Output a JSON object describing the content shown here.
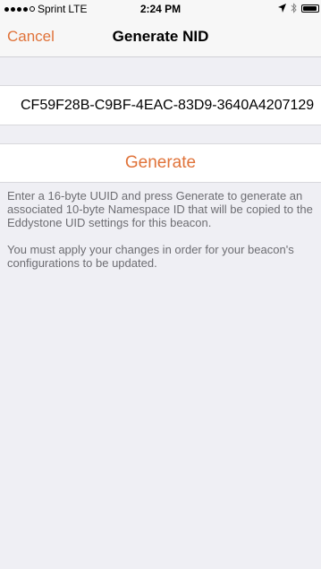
{
  "status_bar": {
    "carrier": "Sprint",
    "network": "LTE",
    "time": "2:24 PM",
    "signal_bars_filled": 4,
    "signal_bars_total": 5,
    "icons": [
      "location-arrow-icon",
      "bluetooth-icon",
      "battery-icon"
    ]
  },
  "nav": {
    "cancel_label": "Cancel",
    "title": "Generate NID"
  },
  "uuid_field": {
    "value": "CF59F28B-C9BF-4EAC-83D9-3640A4207129"
  },
  "generate_button": {
    "label": "Generate"
  },
  "help": {
    "paragraph1": "Enter a 16-byte UUID and press Generate to generate an associated 10-byte Namespace ID that will be copied to the Eddystone UID settings for this beacon.",
    "paragraph2": "You must apply your changes in order for your beacon's configurations to be updated."
  },
  "colors": {
    "accent": "#e0733a",
    "background": "#efeff4",
    "help_text": "#6d6d72"
  }
}
